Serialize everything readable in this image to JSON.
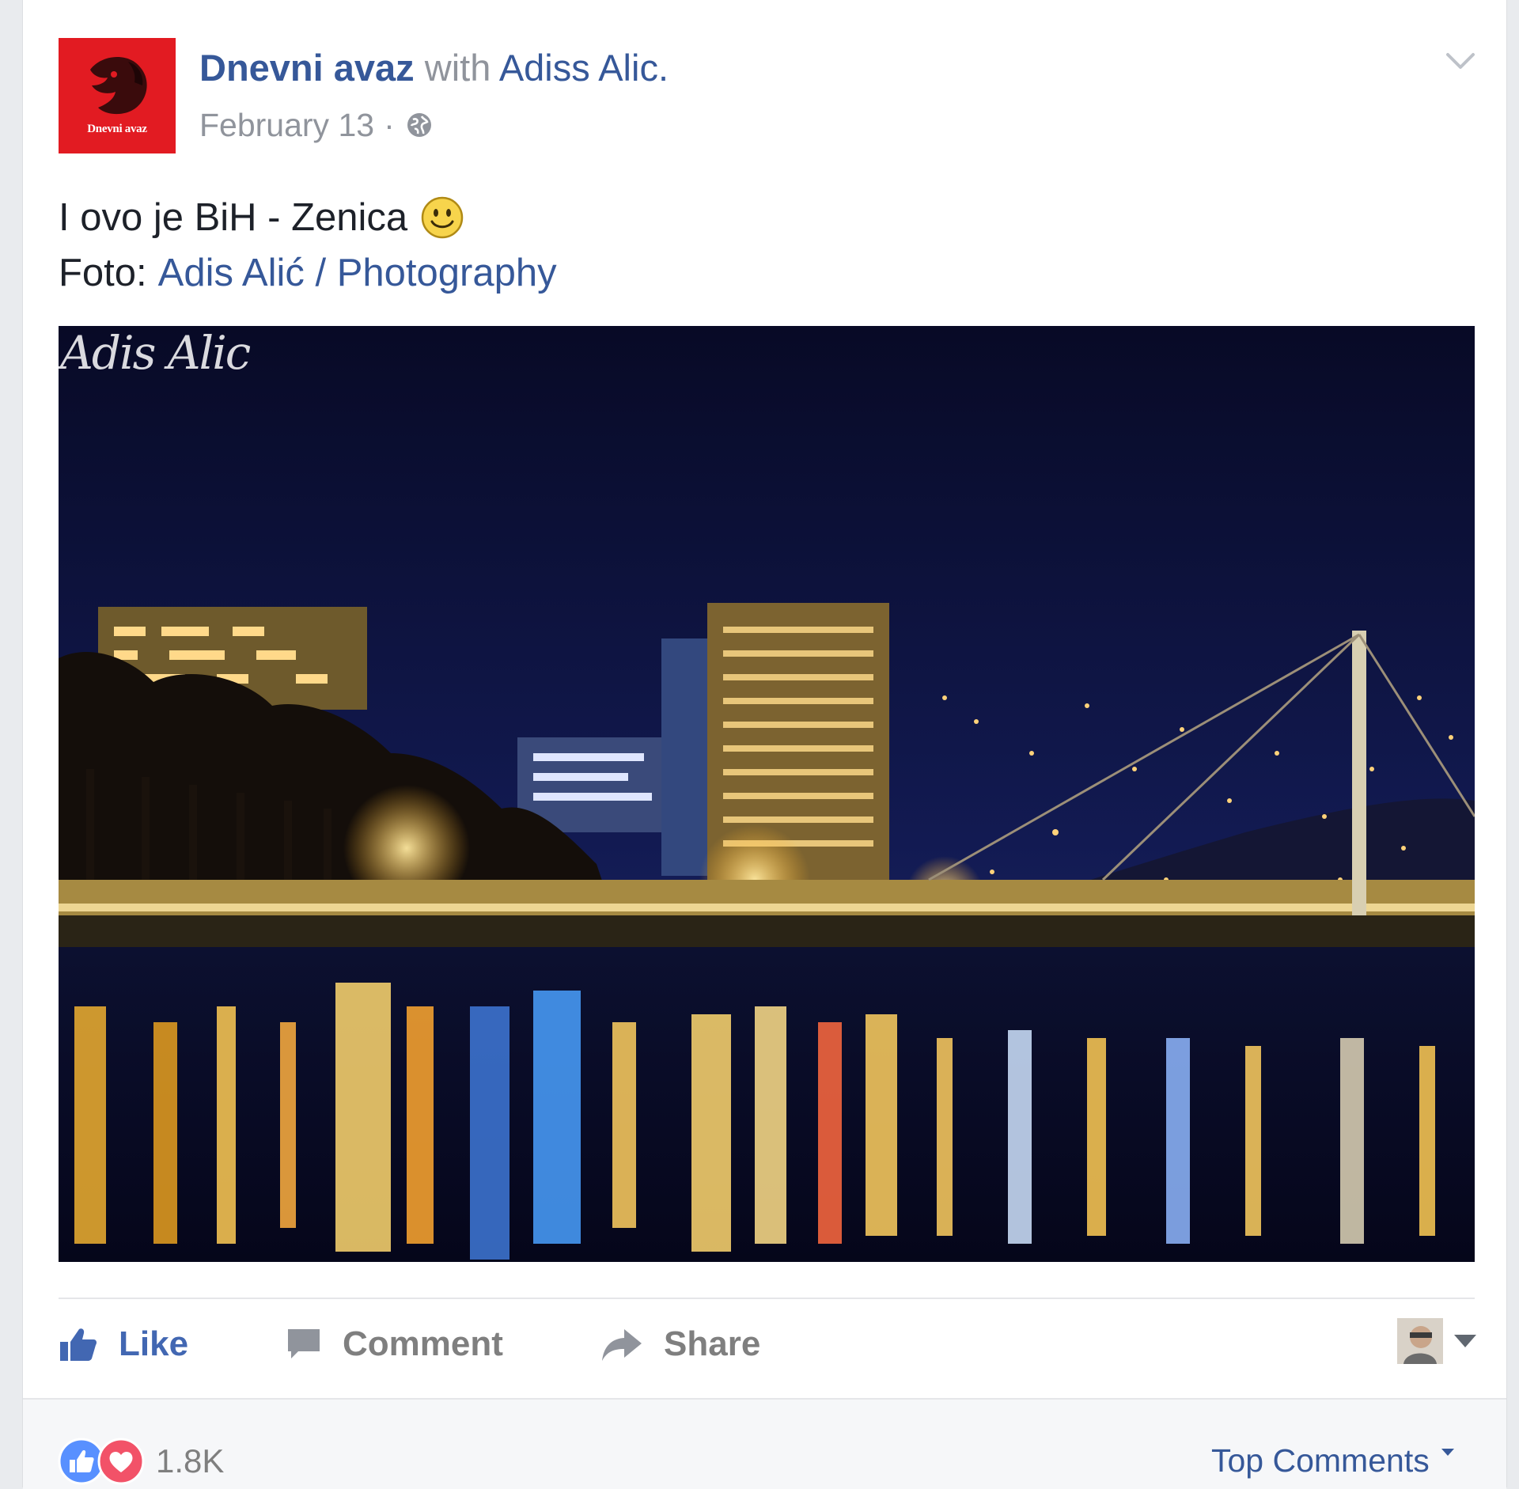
{
  "post": {
    "page_name": "Dnevni avaz",
    "with_label": "with",
    "tagged_user": "Adiss Alic.",
    "date": "February 13",
    "separator": "·",
    "avatar_text": "Dnevni avaz",
    "text_line_1": "I ovo je BiH - Zenica",
    "credit_prefix": "Foto:",
    "credit_link": "Adis Alić / Photography",
    "photo_watermark": "Adis Alic"
  },
  "actions": {
    "like_label": "Like",
    "comment_label": "Comment",
    "share_label": "Share"
  },
  "footer": {
    "reaction_count": "1.8K",
    "sort_label": "Top Comments"
  },
  "colors": {
    "link": "#365899",
    "like_blue": "#4267b2",
    "muted": "#90949c",
    "avatar_red": "#e21b22"
  }
}
